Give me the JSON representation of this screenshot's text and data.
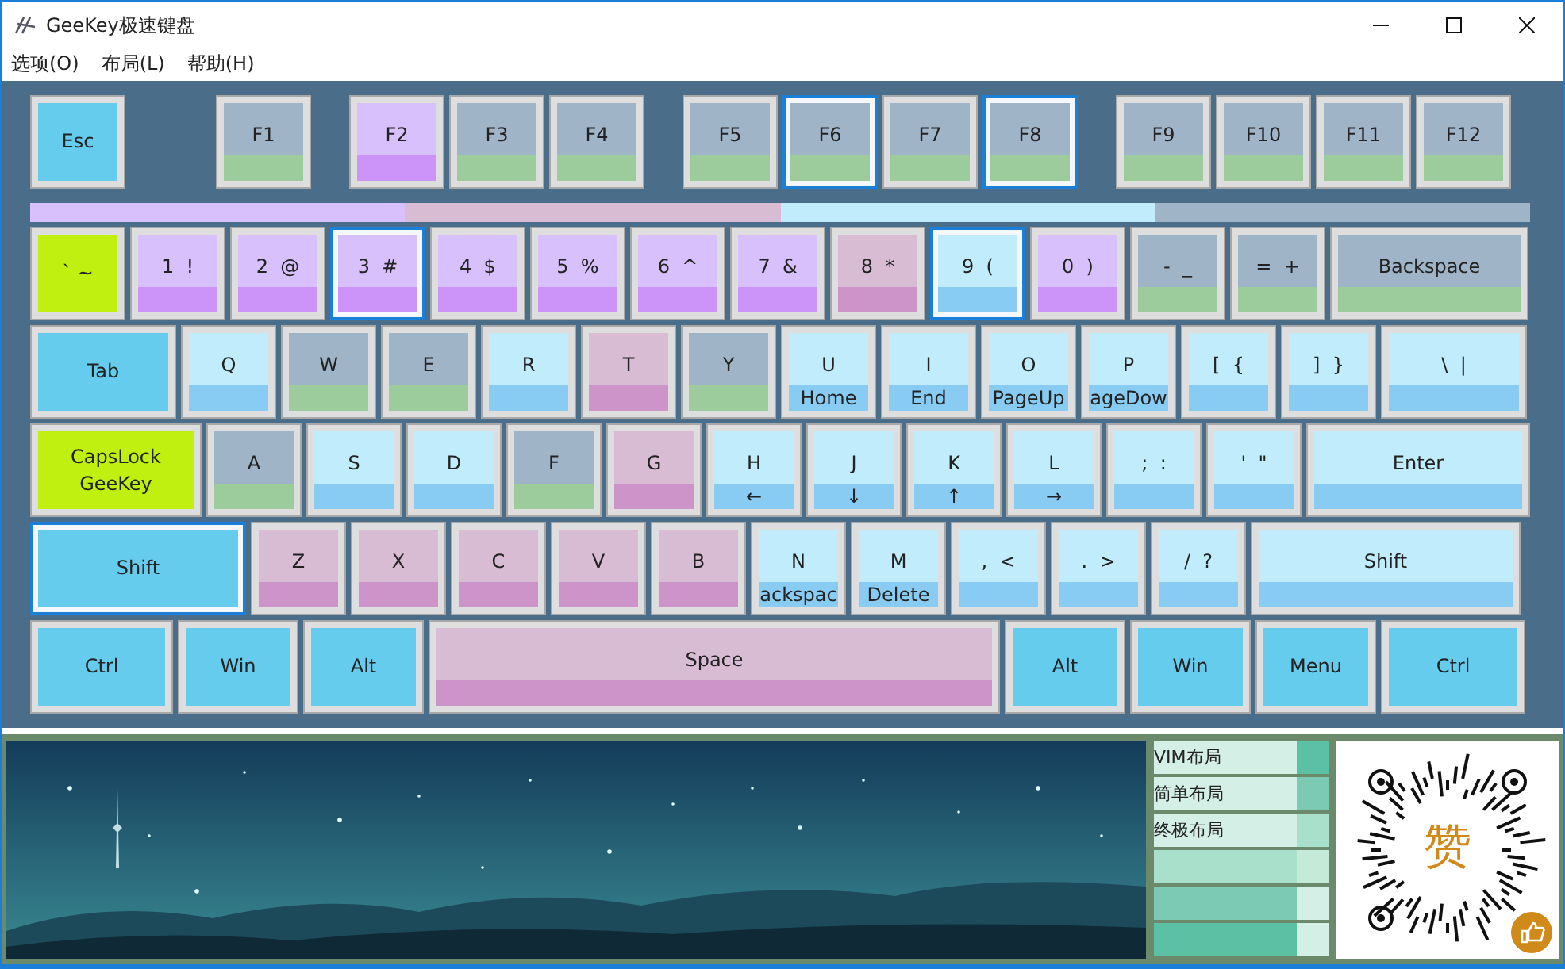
{
  "window": {
    "title": "GeeKey极速键盘"
  },
  "menu": [
    {
      "label": "选项(O)"
    },
    {
      "label": "布局(L)"
    },
    {
      "label": "帮助(H)"
    }
  ],
  "function_row": [
    {
      "label": "Esc",
      "kind": "mod",
      "selected": false
    },
    {
      "label": "F1",
      "kind": "fn",
      "selected": false
    },
    {
      "label": "F2",
      "kind": "num",
      "selected": false
    },
    {
      "label": "F3",
      "kind": "fn",
      "selected": false
    },
    {
      "label": "F4",
      "kind": "fn",
      "selected": false
    },
    {
      "label": "F5",
      "kind": "fn",
      "selected": false
    },
    {
      "label": "F6",
      "kind": "fn",
      "selected": true
    },
    {
      "label": "F7",
      "kind": "fn",
      "selected": false
    },
    {
      "label": "F8",
      "kind": "fn",
      "selected": true
    },
    {
      "label": "F9",
      "kind": "fn",
      "selected": false
    },
    {
      "label": "F10",
      "kind": "fn",
      "selected": false
    },
    {
      "label": "F11",
      "kind": "fn",
      "selected": false
    },
    {
      "label": "F12",
      "kind": "fn",
      "selected": false
    }
  ],
  "color_bar": [
    {
      "color": "#d8c0fc"
    },
    {
      "color": "#d8bcd4"
    },
    {
      "color": "#c0ecfc"
    },
    {
      "color": "#a0b4c8"
    }
  ],
  "rows": [
    [
      {
        "label": "`  ~",
        "kind": "lime",
        "selected": false
      },
      {
        "label": "1  !",
        "kind": "num",
        "selected": false
      },
      {
        "label": "2  @",
        "kind": "num",
        "selected": false
      },
      {
        "label": "3  #",
        "kind": "num",
        "selected": true
      },
      {
        "label": "4  $",
        "kind": "num",
        "selected": false
      },
      {
        "label": "5  %",
        "kind": "num",
        "selected": false
      },
      {
        "label": "6  ^",
        "kind": "num",
        "selected": false
      },
      {
        "label": "7  &",
        "kind": "num",
        "selected": false
      },
      {
        "label": "8  *",
        "kind": "pink",
        "selected": false
      },
      {
        "label": "9  (",
        "kind": "sky",
        "selected": true
      },
      {
        "label": "0  )",
        "kind": "num",
        "selected": false
      },
      {
        "label": "-  _",
        "kind": "fn",
        "selected": false
      },
      {
        "label": "=  +",
        "kind": "fn",
        "selected": false
      },
      {
        "label": "Backspace",
        "kind": "fn",
        "selected": false
      }
    ],
    [
      {
        "label": "Tab",
        "kind": "mod",
        "selected": false
      },
      {
        "label": "Q",
        "kind": "sky",
        "selected": false
      },
      {
        "label": "W",
        "kind": "fn",
        "selected": false
      },
      {
        "label": "E",
        "kind": "fn",
        "selected": false
      },
      {
        "label": "R",
        "kind": "sky",
        "selected": false
      },
      {
        "label": "T",
        "kind": "pink",
        "selected": false
      },
      {
        "label": "Y",
        "kind": "fn",
        "selected": false
      },
      {
        "label": "U",
        "sub": "Home",
        "kind": "sky",
        "selected": false
      },
      {
        "label": "I",
        "sub": "End",
        "kind": "sky",
        "selected": false
      },
      {
        "label": "O",
        "sub": "PageUp",
        "kind": "sky",
        "selected": false
      },
      {
        "label": "P",
        "sub": "ageDow",
        "kind": "sky",
        "selected": false
      },
      {
        "label": "[  {",
        "kind": "sky",
        "selected": false
      },
      {
        "label": "]  }",
        "kind": "sky",
        "selected": false
      },
      {
        "label": "\\  |",
        "kind": "sky",
        "selected": false
      }
    ],
    [
      {
        "label": "CapsLock",
        "sub": "GeeKey",
        "kind": "lime",
        "selected": false
      },
      {
        "label": "A",
        "kind": "fn",
        "selected": false
      },
      {
        "label": "S",
        "kind": "sky",
        "selected": false
      },
      {
        "label": "D",
        "kind": "sky",
        "selected": false
      },
      {
        "label": "F",
        "kind": "fn",
        "selected": false
      },
      {
        "label": "G",
        "kind": "pink",
        "selected": false
      },
      {
        "label": "H",
        "sub": "←",
        "kind": "sky",
        "selected": false
      },
      {
        "label": "J",
        "sub": "↓",
        "kind": "sky",
        "selected": false
      },
      {
        "label": "K",
        "sub": "↑",
        "kind": "sky",
        "selected": false
      },
      {
        "label": "L",
        "sub": "→",
        "kind": "sky",
        "selected": false
      },
      {
        "label": ";  :",
        "kind": "sky",
        "selected": false
      },
      {
        "label": "'  \"",
        "kind": "sky",
        "selected": false
      },
      {
        "label": "Enter",
        "kind": "sky",
        "selected": false
      }
    ],
    [
      {
        "label": "Shift",
        "kind": "mod",
        "selected": true
      },
      {
        "label": "Z",
        "kind": "pink",
        "selected": false
      },
      {
        "label": "X",
        "kind": "pink",
        "selected": false
      },
      {
        "label": "C",
        "kind": "pink",
        "selected": false
      },
      {
        "label": "V",
        "kind": "pink",
        "selected": false
      },
      {
        "label": "B",
        "kind": "pink",
        "selected": false
      },
      {
        "label": "N",
        "sub": "ackspac",
        "kind": "sky",
        "selected": false
      },
      {
        "label": "M",
        "sub": "Delete",
        "kind": "sky",
        "selected": false
      },
      {
        "label": ",  <",
        "kind": "sky",
        "selected": false
      },
      {
        "label": ".  >",
        "kind": "sky",
        "selected": false
      },
      {
        "label": "/  ?",
        "kind": "sky",
        "selected": false
      },
      {
        "label": "Shift",
        "kind": "sky",
        "selected": false
      }
    ],
    [
      {
        "label": "Ctrl",
        "kind": "mod",
        "selected": false
      },
      {
        "label": "Win",
        "kind": "mod",
        "selected": false
      },
      {
        "label": "Alt",
        "kind": "mod",
        "selected": false
      },
      {
        "label": "Space",
        "kind": "pink",
        "selected": false
      },
      {
        "label": "Alt",
        "kind": "mod",
        "selected": false
      },
      {
        "label": "Win",
        "kind": "mod",
        "selected": false
      },
      {
        "label": "Menu",
        "kind": "mod",
        "selected": false
      },
      {
        "label": "Ctrl",
        "kind": "mod",
        "selected": false
      }
    ]
  ],
  "layouts": [
    {
      "kind": "named",
      "label": "VIM布局"
    },
    {
      "kind": "named",
      "label": "简单布局"
    },
    {
      "kind": "named",
      "label": "终极布局"
    },
    {
      "kind": "empty"
    },
    {
      "kind": "empty"
    },
    {
      "kind": "empty"
    }
  ],
  "reward_code": {
    "center": "赞"
  }
}
